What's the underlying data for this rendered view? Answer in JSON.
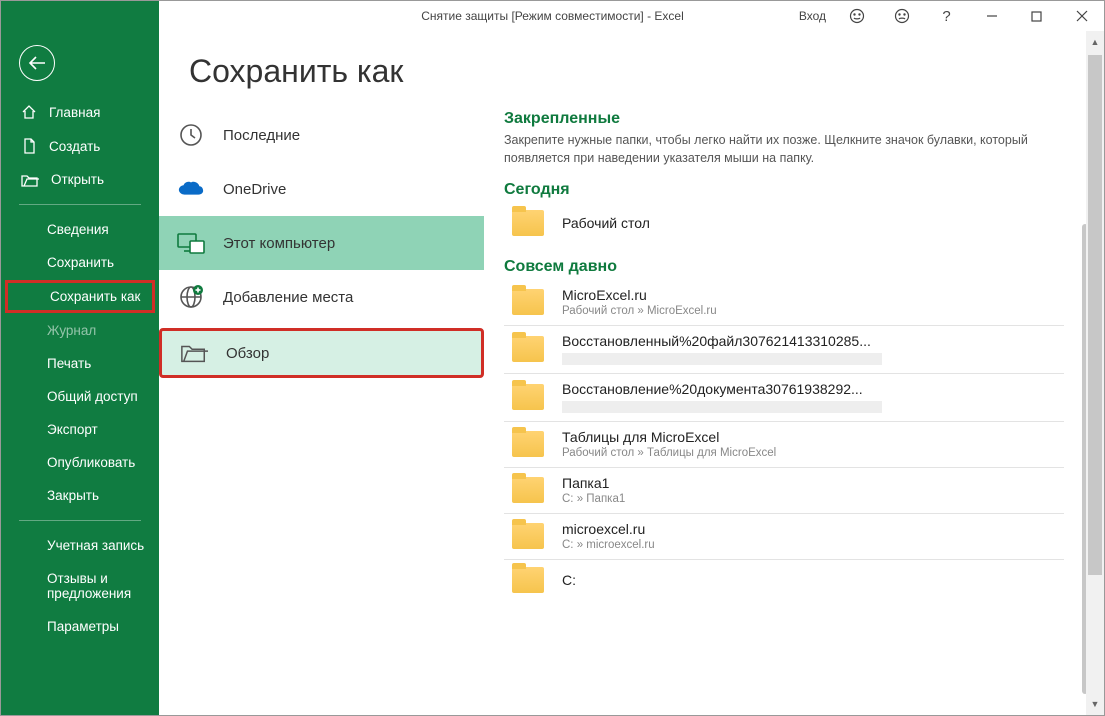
{
  "titlebar": {
    "document": "Снятие защиты  [Режим совместимости]  -  Excel",
    "login": "Вход"
  },
  "sidebar": {
    "home": "Главная",
    "new": "Создать",
    "open": "Открыть",
    "info": "Сведения",
    "save": "Сохранить",
    "save_as": "Сохранить как",
    "history": "Журнал",
    "print": "Печать",
    "share": "Общий доступ",
    "export": "Экспорт",
    "publish": "Опубликовать",
    "close": "Закрыть",
    "account": "Учетная запись",
    "feedback1": "Отзывы и",
    "feedback2": "предложения",
    "options": "Параметры"
  },
  "page": {
    "title": "Сохранить как"
  },
  "locations": {
    "recent": "Последние",
    "onedrive": "OneDrive",
    "this_pc": "Этот компьютер",
    "add_place": "Добавление места",
    "browse": "Обзор"
  },
  "folders": {
    "pinned_head": "Закрепленные",
    "pinned_sub": "Закрепите нужные папки, чтобы легко найти их позже. Щелкните значок булавки, который появляется при наведении указателя мыши на папку.",
    "today_head": "Сегодня",
    "older_head": "Совсем давно",
    "today": [
      {
        "name": "Рабочий стол",
        "path": ""
      }
    ],
    "older": [
      {
        "name": "MicroExcel.ru",
        "path": "Рабочий стол » MicroExcel.ru"
      },
      {
        "name": "Восстановленный%20файл307621413310285...",
        "path": "blur"
      },
      {
        "name": "Восстановление%20документа30761938292...",
        "path": "blur"
      },
      {
        "name": "Таблицы для MicroExcel",
        "path": "Рабочий стол » Таблицы для MicroExcel"
      },
      {
        "name": "Папка1",
        "path": "C: » Папка1"
      },
      {
        "name": "microexcel.ru",
        "path": "C: » microexcel.ru"
      },
      {
        "name": "C:",
        "path": ""
      }
    ]
  }
}
